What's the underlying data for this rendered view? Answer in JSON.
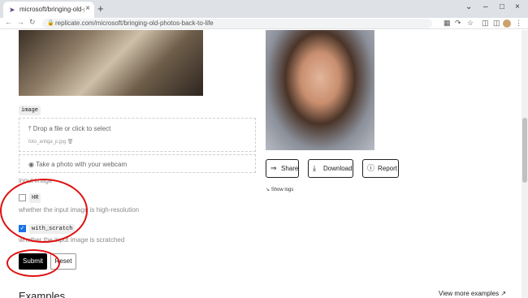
{
  "browser": {
    "tab_title": "microsoft/bringing-old-photos-…",
    "new_tab_icon": "plus-icon",
    "url": "replicate.com/microsoft/bringing-old-photos-back-to-life"
  },
  "form": {
    "image_label": "image",
    "drop_text": "Drop a file or click to select",
    "file_name": "foto_antiga_p.jpg",
    "webcam_text": "Take a photo with your webcam",
    "image_hint": "input image",
    "hr_label": "HR",
    "hr_checked": false,
    "hr_hint": "whether the input image is high-resolution",
    "scratch_label": "with_scratch",
    "scratch_checked": true,
    "scratch_hint": "whether the input image is scratched",
    "submit_label": "Submit",
    "reset_label": "Reset"
  },
  "output": {
    "share_label": "Share",
    "download_label": "Download",
    "report_label": "Report",
    "show_logs_label": "Show logs"
  },
  "examples": {
    "heading": "Examples",
    "view_more_label": "View more examples ↗"
  },
  "colors": {
    "annotation": "#e01010",
    "checkbox_accent": "#1a73e8"
  }
}
